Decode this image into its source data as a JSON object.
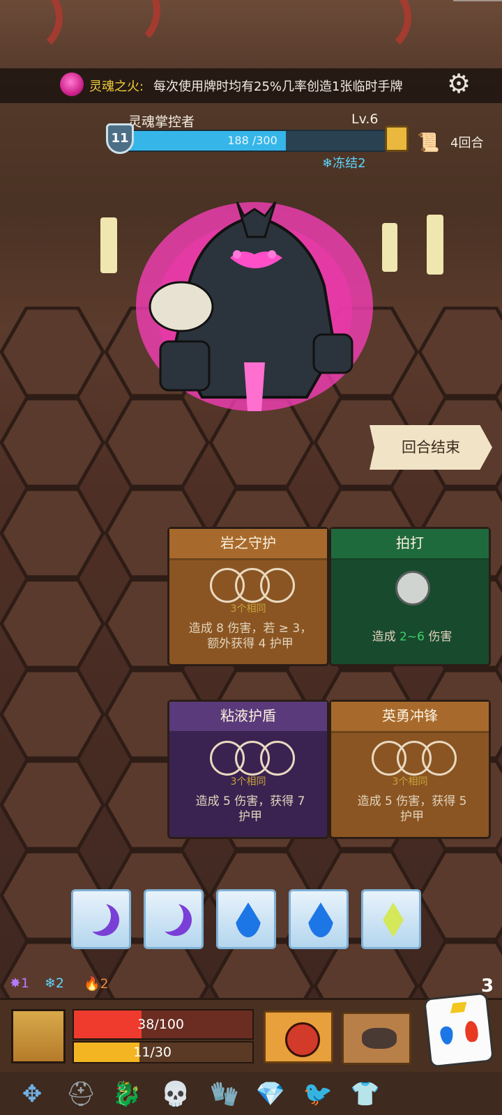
{
  "buff": {
    "name": "灵魂之火:",
    "description": "每次使用牌时均有25%几率创造1张临时手牌",
    "icon": "pink-flame-skull-icon"
  },
  "enemy": {
    "name": "灵魂掌控者",
    "level": "Lv.6",
    "armor": "11",
    "hp_current": 188,
    "hp_max": 300,
    "hp_text": "188 /300",
    "hp_fraction": 0.627,
    "status": "冻结2"
  },
  "round": {
    "label": "4回合"
  },
  "buttons": {
    "end_turn": "回合结束"
  },
  "cards": [
    {
      "title": "岩之守护",
      "requirement": "3个相同",
      "effect_line1": "造成 8 伤害，若 ≥ 3，",
      "effect_line2": "额外获得 4 护甲",
      "color": "#a86a2c"
    },
    {
      "title": "拍打",
      "requirement": "",
      "effect_prefix": "造成 ",
      "effect_range": "2~6",
      "effect_suffix": " 伤害",
      "color": "#1f6a3d"
    },
    {
      "title": "粘液护盾",
      "requirement": "3个相同",
      "effect_line1": "造成 5 伤害，获得 7",
      "effect_line2": "护甲",
      "color": "#5a3a7a"
    },
    {
      "title": "英勇冲锋",
      "requirement": "3个相同",
      "effect_line1": "造成 5 伤害，获得 5",
      "effect_line2": "护甲",
      "color": "#a86a2c"
    }
  ],
  "dice_tray": [
    "moon",
    "moon",
    "water",
    "water",
    "diamond"
  ],
  "status_counts": {
    "purple": "1",
    "frost": "2",
    "fire": "2"
  },
  "dice_remaining": "3",
  "player": {
    "hp_text": "38/100",
    "hp_fraction": 0.38,
    "mp_text": "11/30",
    "mp_fraction": 0.367
  },
  "relics": [
    "compass-icon",
    "helmet-icon",
    "blue-dragon-icon",
    "skull-icon",
    "gauntlet-icon",
    "ruby-amulet-icon",
    "golden-bird-icon",
    "blue-tunic-icon"
  ]
}
